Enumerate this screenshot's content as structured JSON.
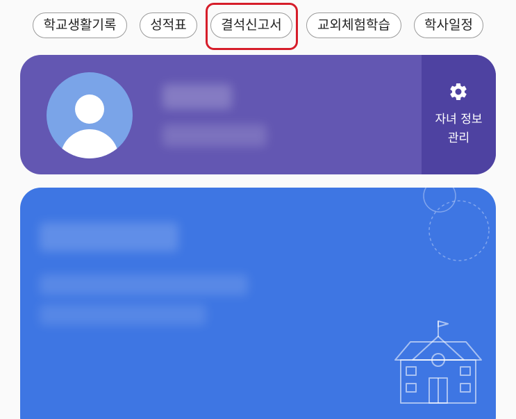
{
  "menu": {
    "chips": [
      {
        "label": "학교생활기록"
      },
      {
        "label": "성적표"
      },
      {
        "label": "결석신고서"
      },
      {
        "label": "교외체험학습"
      },
      {
        "label": "학사일정"
      }
    ],
    "highlighted_index": 2
  },
  "profile_card": {
    "manage_label_line1": "자녀 정보",
    "manage_label_line2": "관리",
    "manage_icon": "gear-icon"
  },
  "class_card": {
    "illustration": "school-building-icon"
  },
  "colors": {
    "profile_card_bg": "#6357b2",
    "manage_panel_bg": "#4e42a1",
    "avatar_bg": "#7aa4e8",
    "class_card_bg": "#3e76e3",
    "highlight_ring": "#d61d2a"
  }
}
